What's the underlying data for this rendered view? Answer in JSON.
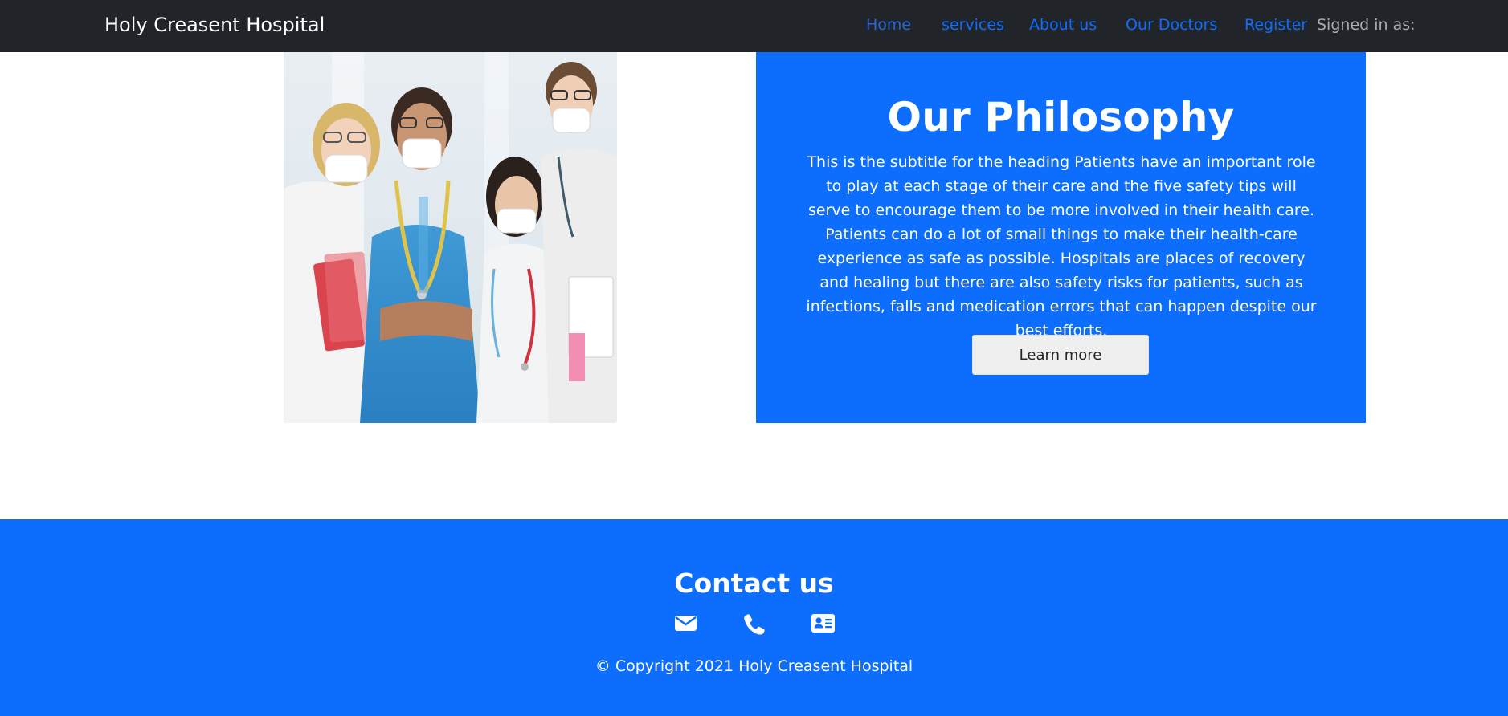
{
  "navbar": {
    "brand": "Holy Creasent Hospital",
    "links": [
      {
        "label": "Home",
        "active": true
      },
      {
        "label": "services"
      },
      {
        "label": "About us"
      },
      {
        "label": "Our Doctors"
      },
      {
        "label": "Register"
      }
    ],
    "signed_in_label": "Signed in as:"
  },
  "hero": {
    "image_alt": "doctors-team-photo"
  },
  "philosophy": {
    "title": "Our Philosophy",
    "text": "This is the subtitle for the heading Patients have an important role to play at each stage of their care and the five safety tips will serve to encourage them to be more involved in their health care. Patients can do a lot of small things to make their health-care experience as safe as possible. Hospitals are places of recovery and healing but there are also safety risks for patients, such as infections, falls and medication errors that can happen despite our best efforts.",
    "button_label": "Learn more"
  },
  "footer": {
    "contact_title": "Contact us",
    "icons": [
      "envelope-icon",
      "phone-icon",
      "address-card-icon"
    ],
    "copyright": "© Copyright 2021 Holy Creasent Hospital"
  },
  "colors": {
    "navbar_bg": "#212529",
    "primary": "#0d6efd",
    "button_bg": "#efefef"
  }
}
